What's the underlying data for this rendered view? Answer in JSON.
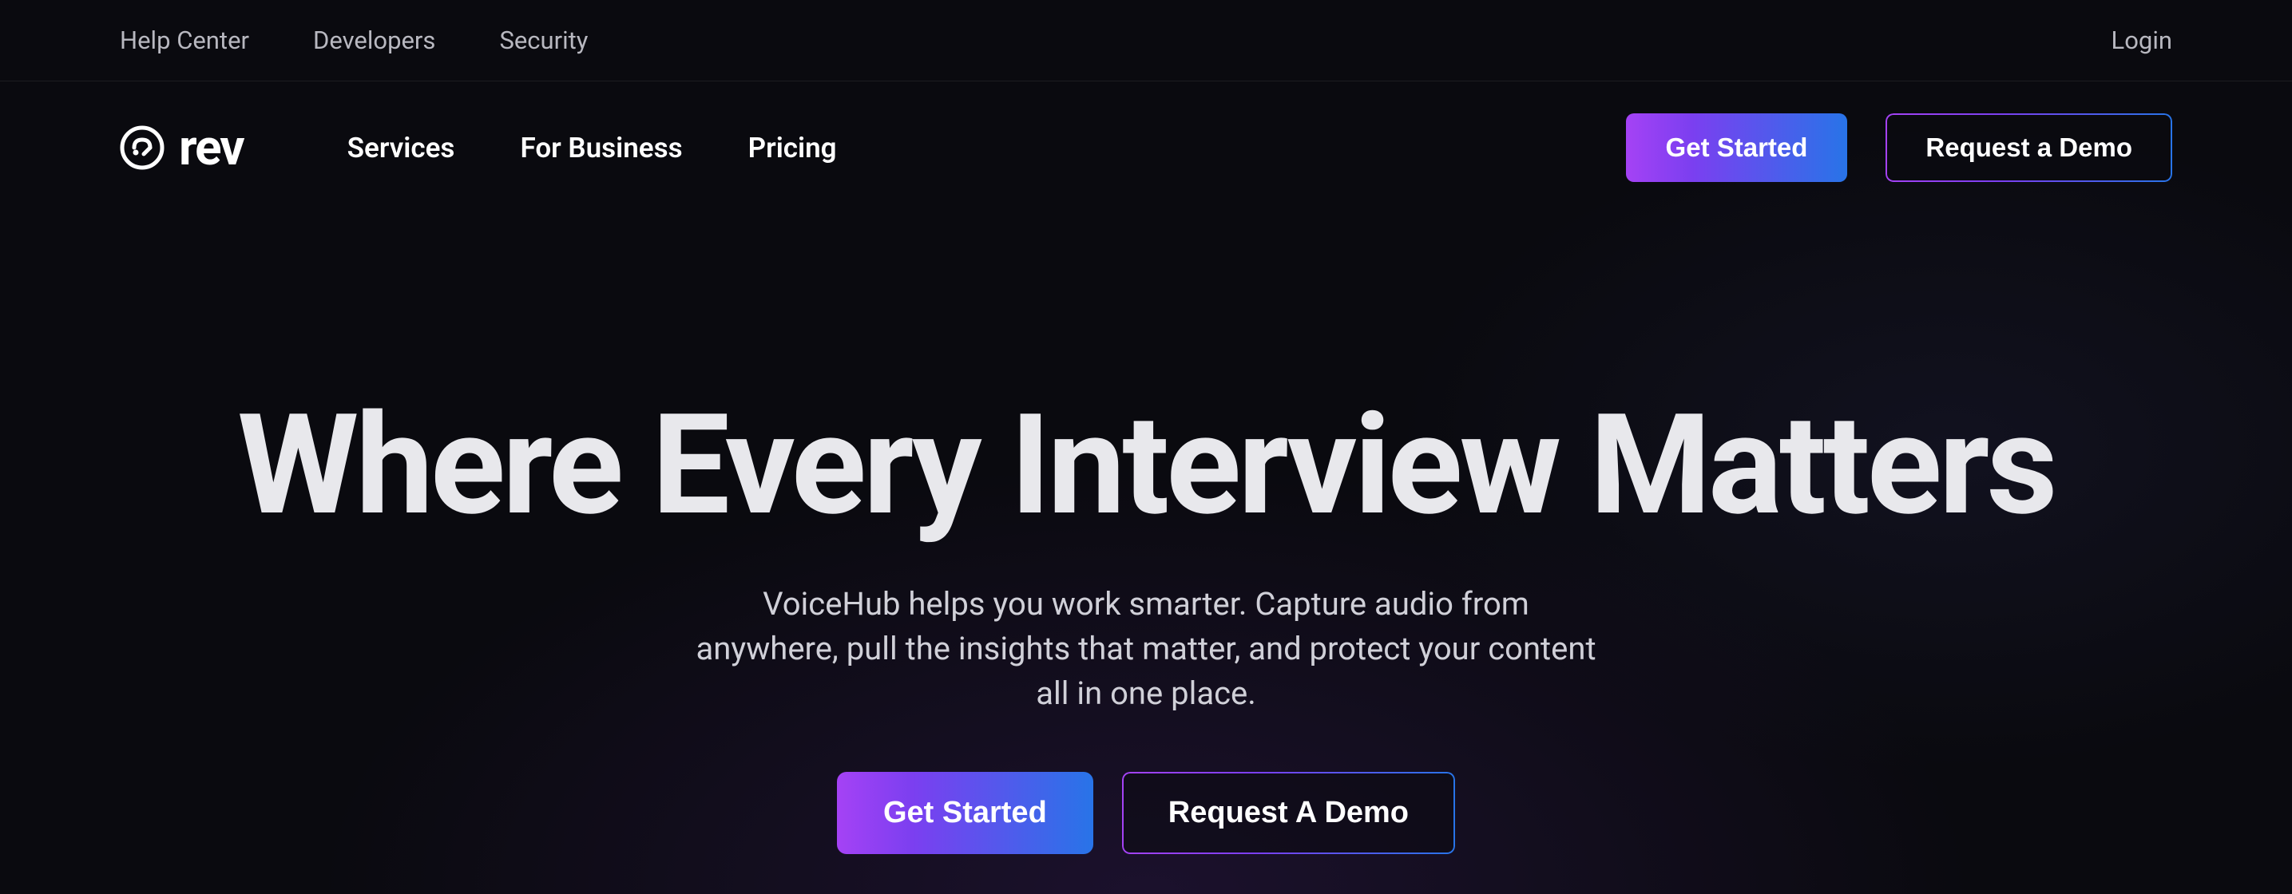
{
  "topBar": {
    "links": [
      "Help Center",
      "Developers",
      "Security"
    ],
    "login": "Login"
  },
  "nav": {
    "brand": "rev",
    "links": [
      "Services",
      "For Business",
      "Pricing"
    ],
    "getStarted": "Get Started",
    "requestDemo": "Request a Demo"
  },
  "hero": {
    "title": "Where Every Interview Matters",
    "subtitle": "VoiceHub helps you work smarter. Capture audio from anywhere, pull the insights that matter, and protect your content all in one place.",
    "getStarted": "Get Started",
    "requestDemo": "Request A Demo"
  }
}
